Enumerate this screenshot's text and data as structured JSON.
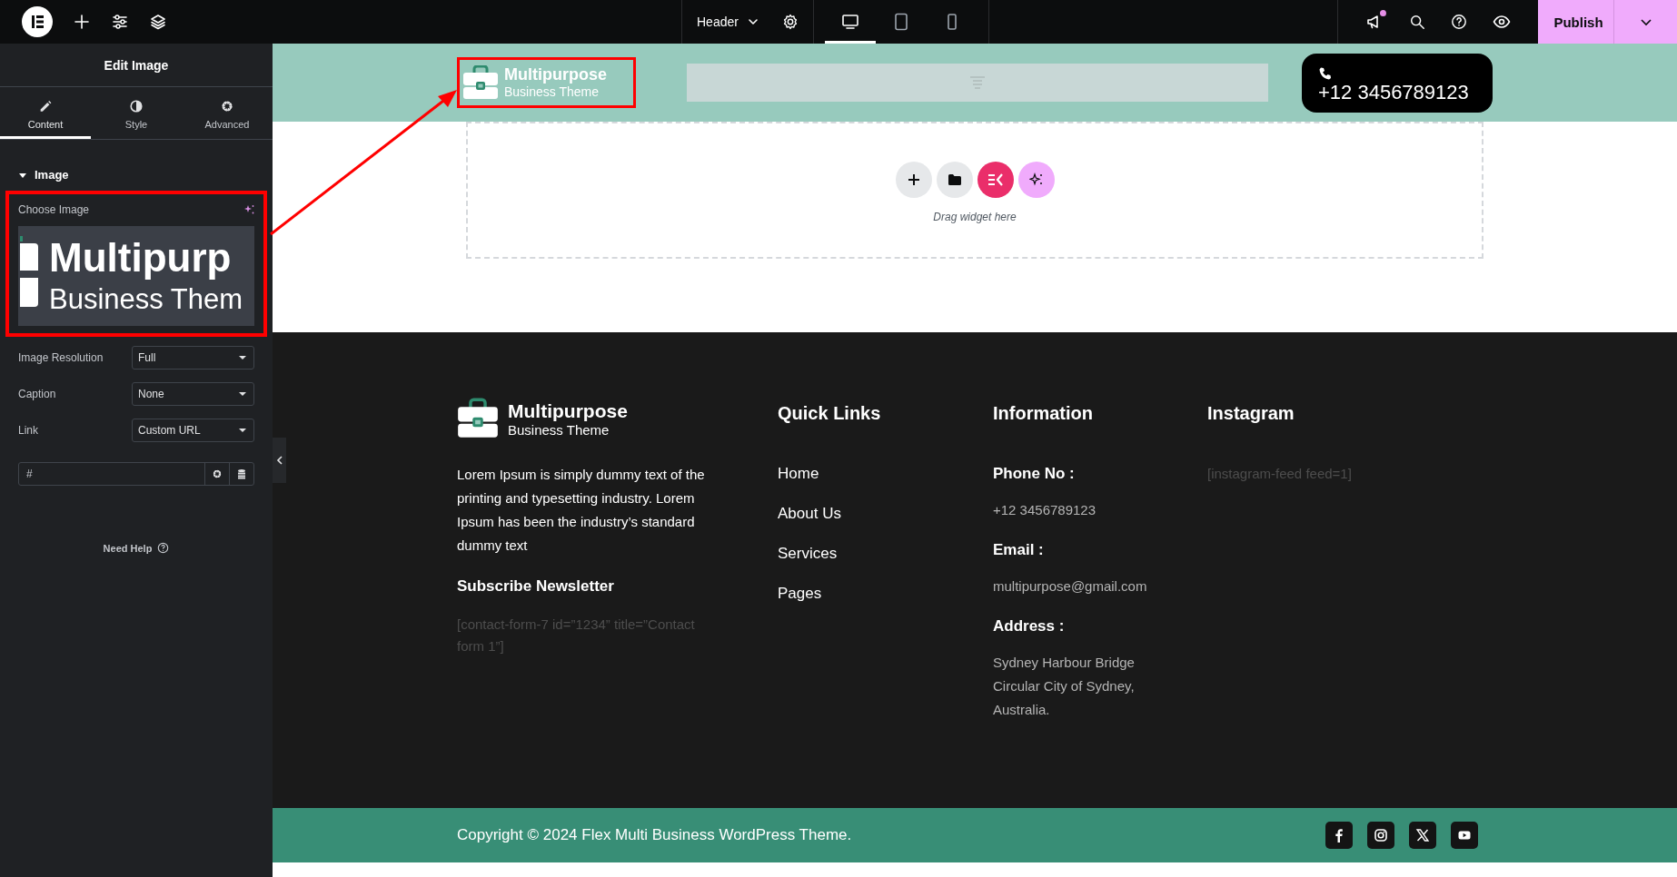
{
  "topbar": {
    "document_label": "Header",
    "devices": [
      {
        "kind": "desktop",
        "selected": true
      },
      {
        "kind": "tablet",
        "selected": false
      },
      {
        "kind": "mobile",
        "selected": false
      }
    ],
    "has_notification": true,
    "publish_label": "Publish"
  },
  "panel": {
    "title": "Edit Image",
    "tabs": [
      {
        "kind": "content",
        "label": "Content",
        "selected": true
      },
      {
        "kind": "style",
        "label": "Style",
        "selected": false
      },
      {
        "kind": "advanced",
        "label": "Advanced",
        "selected": false
      }
    ],
    "section": {
      "title": "Image",
      "expanded": true
    },
    "choose_image": {
      "label": "Choose Image",
      "preview_lines": [
        "Multipurp",
        "Business Them"
      ]
    },
    "controls": [
      {
        "kind": "select",
        "label": "Image Resolution",
        "value": "Full"
      },
      {
        "kind": "select",
        "label": "Caption",
        "value": "None"
      },
      {
        "kind": "select",
        "label": "Link",
        "value": "Custom URL"
      },
      {
        "kind": "url",
        "value": "#"
      }
    ],
    "help": "Need Help"
  },
  "header": {
    "logo": {
      "title": "Multipurpose",
      "subtitle": "Business Theme"
    },
    "phone": "+12 3456789123"
  },
  "drop_zone": {
    "hint": "Drag widget here"
  },
  "footer": {
    "logo": {
      "title": "Multipurpose",
      "subtitle": "Business Theme"
    },
    "about": "Lorem Ipsum is simply dummy text of the printing and typesetting industry. Lorem Ipsum has been the industry’s standard dummy text",
    "newsletter_title": "Subscribe Newsletter",
    "newsletter_shortcode": "[contact-form-7 id=”1234” title=”Contact form 1”]",
    "quick_links_title": "Quick Links",
    "quick_links": [
      "Home",
      "About Us",
      "Services",
      "Pages"
    ],
    "information_title": "Information",
    "information": [
      {
        "label": "Phone No :",
        "lines": [
          "+12 3456789123"
        ]
      },
      {
        "label": "Email :",
        "lines": [
          "multipurpose@gmail.com"
        ]
      },
      {
        "label": "Address :",
        "lines": [
          "Sydney Harbour Bridge",
          "Circular City of Sydney,",
          "Australia."
        ]
      }
    ],
    "instagram_title": "Instagram",
    "instagram_shortcode": "[instagram-feed feed=1]"
  },
  "bottom_bar": {
    "copyright": "Copyright © 2024 Flex Multi Business WordPress Theme.",
    "social": [
      {
        "kind": "facebook"
      },
      {
        "kind": "instagram"
      },
      {
        "kind": "x"
      },
      {
        "kind": "youtube"
      }
    ]
  },
  "callout": {
    "color": "#ff0000"
  }
}
